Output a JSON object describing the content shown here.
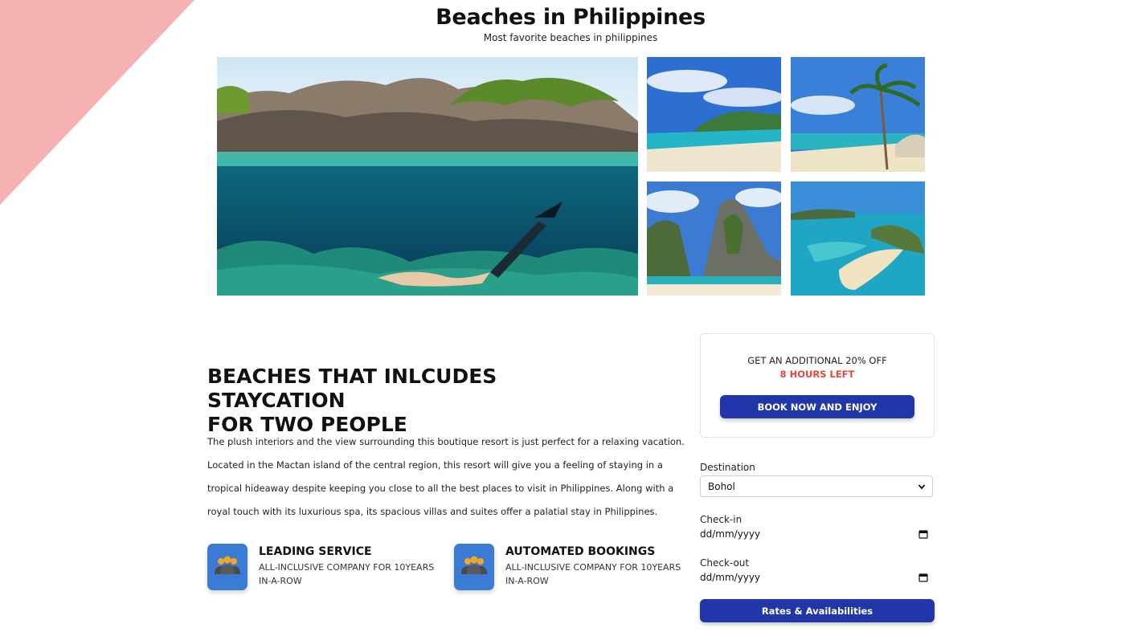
{
  "header": {
    "title": "Beaches in Philippines",
    "subtitle": "Most favorite beaches in philippines"
  },
  "gallery": {
    "images": [
      "underwater-snorkel-photo",
      "beach-photo",
      "palm-beach-photo",
      "limestone-cliff-photo",
      "island-sandbar-photo"
    ]
  },
  "main": {
    "heading_line1": "BEACHES THAT INLCUDES STAYCATION",
    "heading_line2": "FOR TWO PEOPLE",
    "paragraph": "The plush interiors and the view surrounding this boutique resort is just perfect for a relaxing vacation. Located in the Mactan island of the central region, this resort will give you a feeling of staying in a tropical hideaway despite keeping you close to all the best places to visit in Philippines. Along with a royal touch with its luxurious spa, its spacious villas and suites offer a palatial stay in Philippines.",
    "features": [
      {
        "icon": "people-group-icon",
        "title": "LEADING SERVICE",
        "desc": "ALL-INCLUSIVE COMPANY FOR 10YEARS IN-A-ROW"
      },
      {
        "icon": "people-group-icon",
        "title": "AUTOMATED BOOKINGS",
        "desc": "ALL-INCLUSIVE COMPANY FOR 10YEARS IN-A-ROW"
      }
    ]
  },
  "promo": {
    "line1": "GET AN ADDITIONAL 20% OFF",
    "line2": "8 HOURS LEFT",
    "button_label": "BOOK NOW AND ENJOY"
  },
  "booking": {
    "destination_label": "Destination",
    "destination_value": "Bohol",
    "checkin_label": "Check-in",
    "checkin_value": "dd/mm/yyyy",
    "checkout_label": "Check-out",
    "checkout_value": "dd/mm/yyyy",
    "submit_label": "Rates & Availabilities"
  },
  "colors": {
    "accent": "#2136a8",
    "corner": "#f6b1b3",
    "urgent": "#e8453c",
    "feature_icon_bg": "#3a7bd5"
  }
}
